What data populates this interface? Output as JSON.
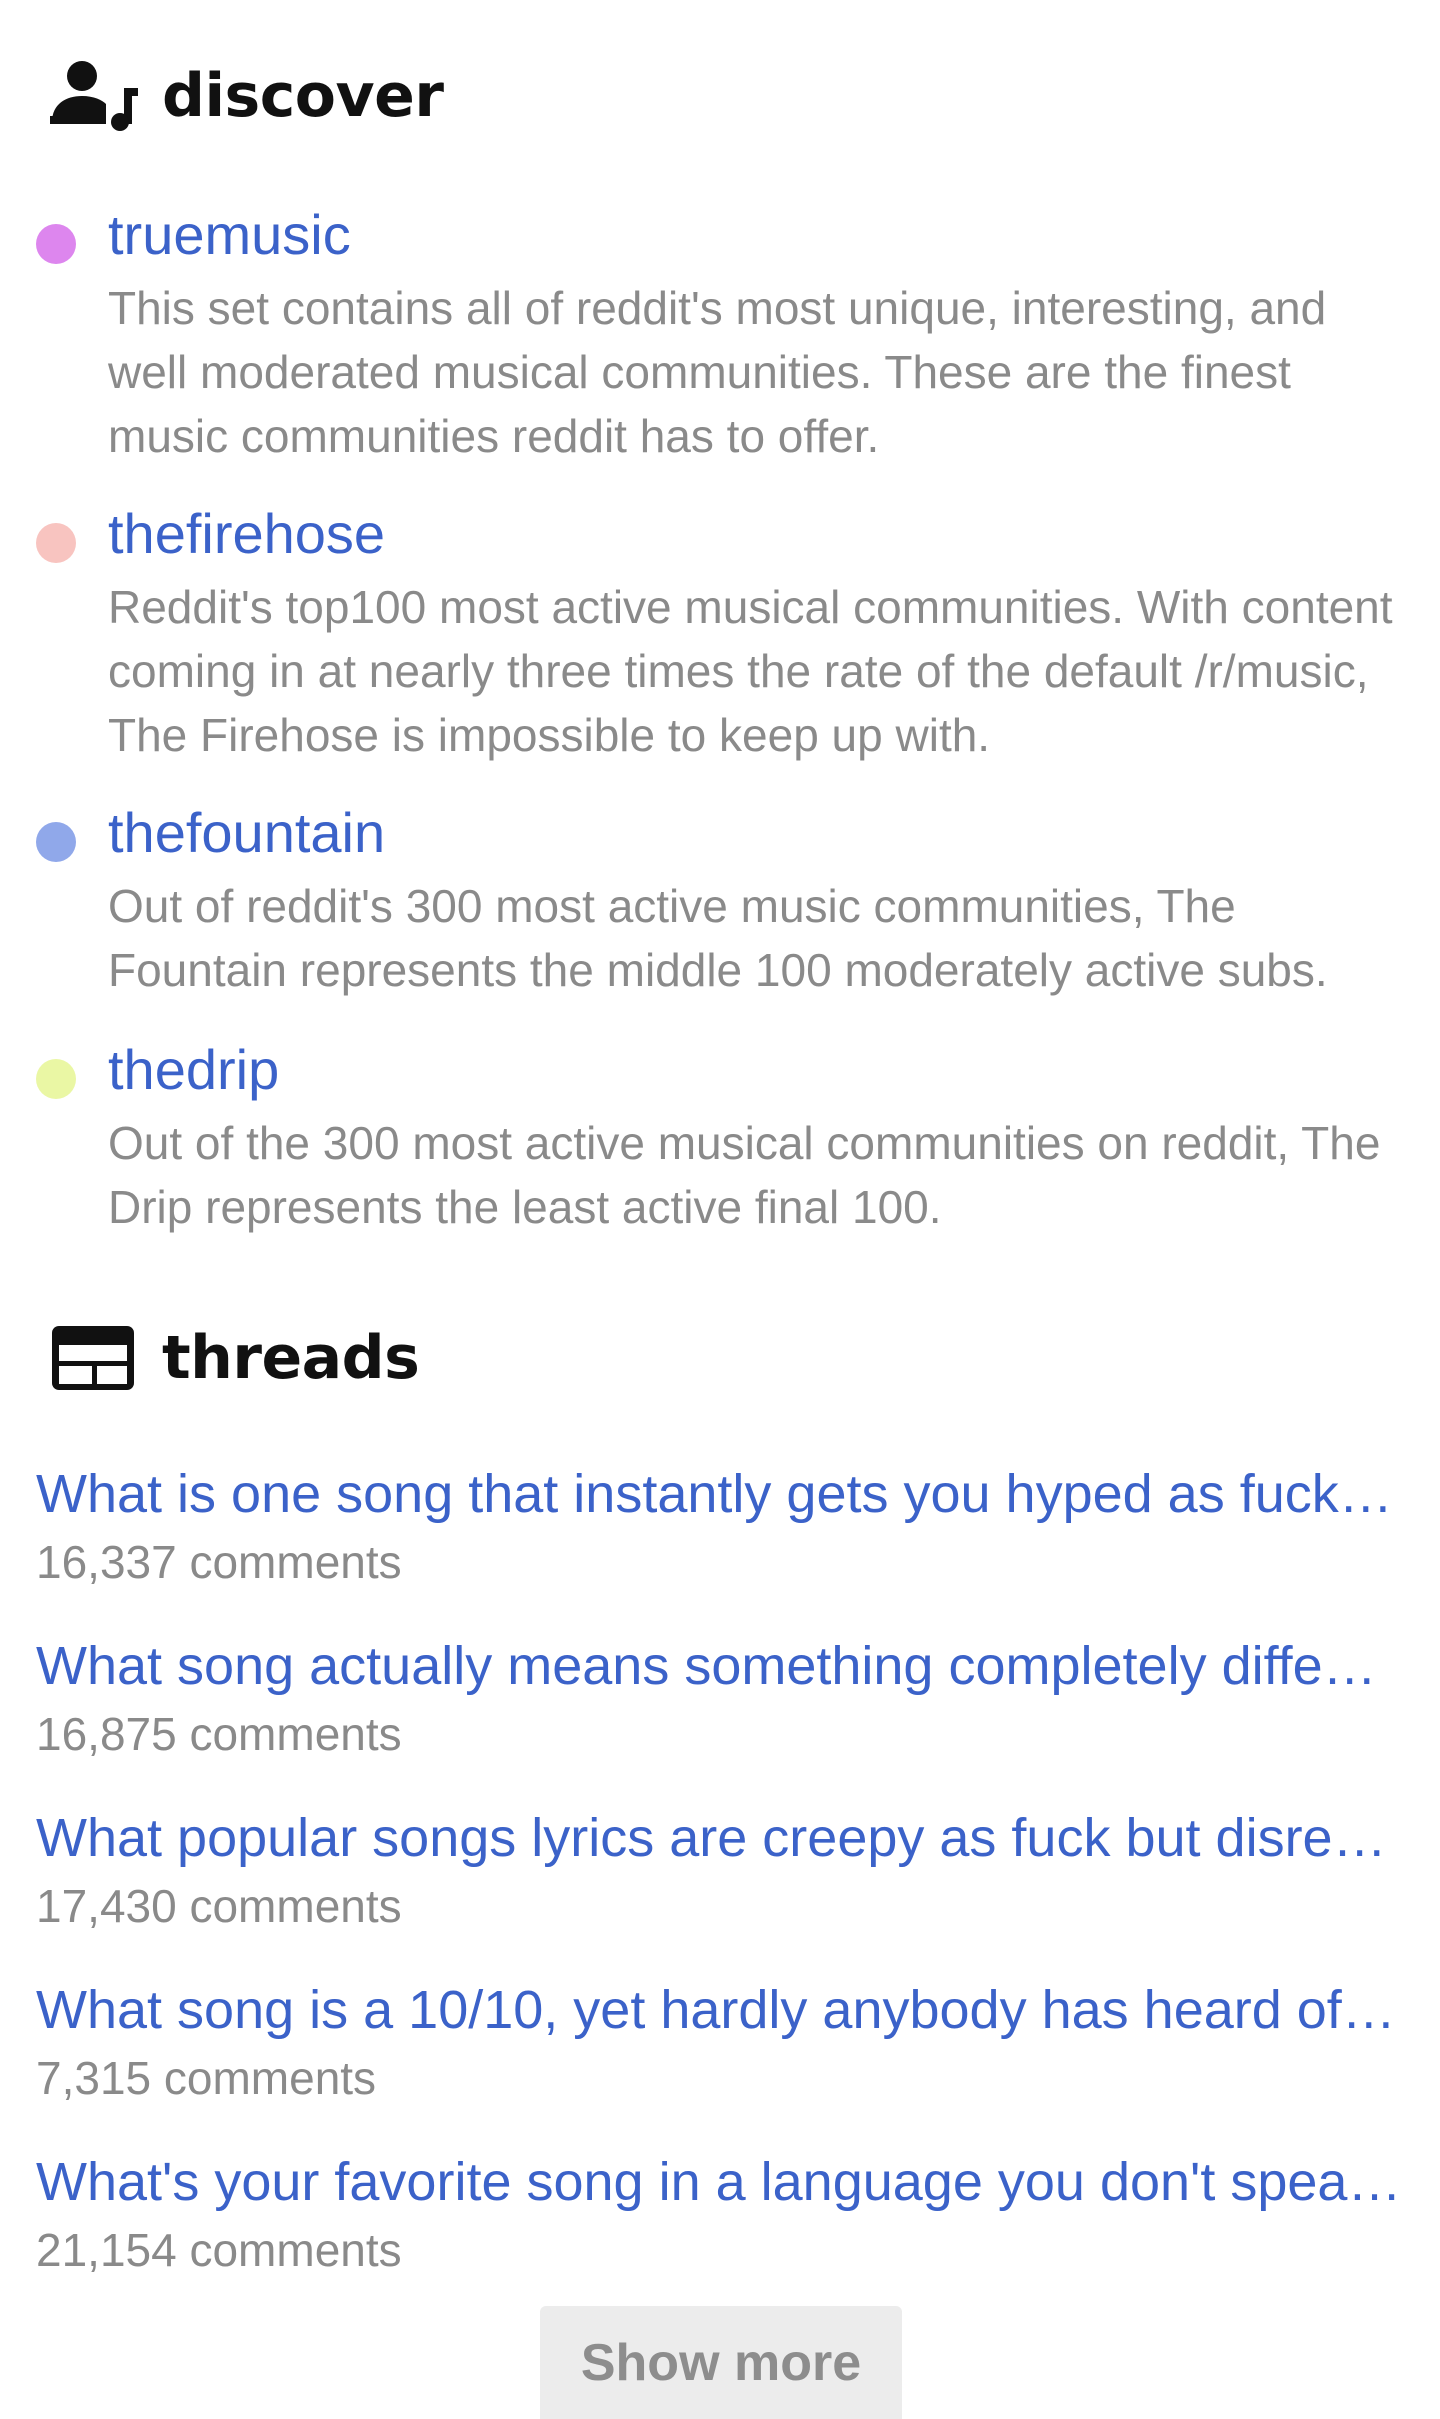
{
  "discover": {
    "title": "discover",
    "icon": "person-music-icon",
    "sets": [
      {
        "name": "truemusic",
        "color": "#dd86ee",
        "description": "This set contains all of reddit's most unique, interesting, and well moderated musical communities. These are the finest music communities reddit has to offer."
      },
      {
        "name": "thefirehose",
        "color": "#f8c4c0",
        "description": "Reddit's top100 most active musical communities. With content coming in at nearly three times the rate of the default /r/music, The Firehose is impossible to keep up with."
      },
      {
        "name": "thefountain",
        "color": "#90a8ea",
        "description": "Out of reddit's 300 most active music communities, The Fountain represents the middle 100 moderately active subs."
      },
      {
        "name": "thedrip",
        "color": "#eaf7a4",
        "description": "Out of the 300 most active musical communities on reddit, The Drip represents the least active final 100."
      }
    ]
  },
  "threads": {
    "title": "threads",
    "icon": "web-layout-icon",
    "items": [
      {
        "title": "What is one song that instantly gets you hyped as fuck…",
        "comments": "16,337 comments"
      },
      {
        "title": "What song actually means something completely diffe…",
        "comments": "16,875 comments"
      },
      {
        "title": "What popular songs lyrics are creepy as fuck but disre…",
        "comments": "17,430 comments"
      },
      {
        "title": "What song is a 10/10, yet hardly anybody has heard of…",
        "comments": "7,315 comments"
      },
      {
        "title": "What's your favorite song in a language you don't spea…",
        "comments": "21,154 comments"
      }
    ],
    "show_more_label": "Show more"
  },
  "colors": {
    "link": "#3b62c9",
    "muted_text": "#8a8a8a",
    "heading": "#111111",
    "button_bg": "#ececec"
  }
}
